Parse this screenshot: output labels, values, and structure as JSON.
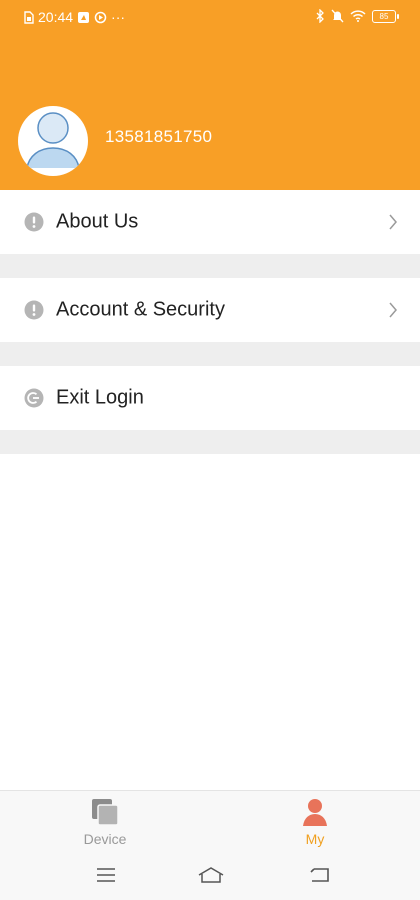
{
  "status_bar": {
    "time": "20:44",
    "more": "···",
    "battery": "85"
  },
  "profile": {
    "phone": "13581851750"
  },
  "menu": {
    "items": [
      {
        "label": "About Us",
        "icon": "info-icon",
        "has_chevron": true
      },
      {
        "label": "Account & Security",
        "icon": "info-icon",
        "has_chevron": true
      },
      {
        "label": "Exit Login",
        "icon": "logout-icon",
        "has_chevron": false
      }
    ]
  },
  "tabbar": {
    "tabs": [
      {
        "label": "Device",
        "icon": "device-icon",
        "active": false
      },
      {
        "label": "My",
        "icon": "person-icon",
        "active": true
      }
    ]
  },
  "colors": {
    "accent": "#f89f26",
    "active_tab_icon": "#e8735a",
    "active_tab_label": "#f0a020",
    "inactive_tab": "#999999",
    "menu_icon": "#b5b5b5",
    "divider": "#eeeeee"
  }
}
